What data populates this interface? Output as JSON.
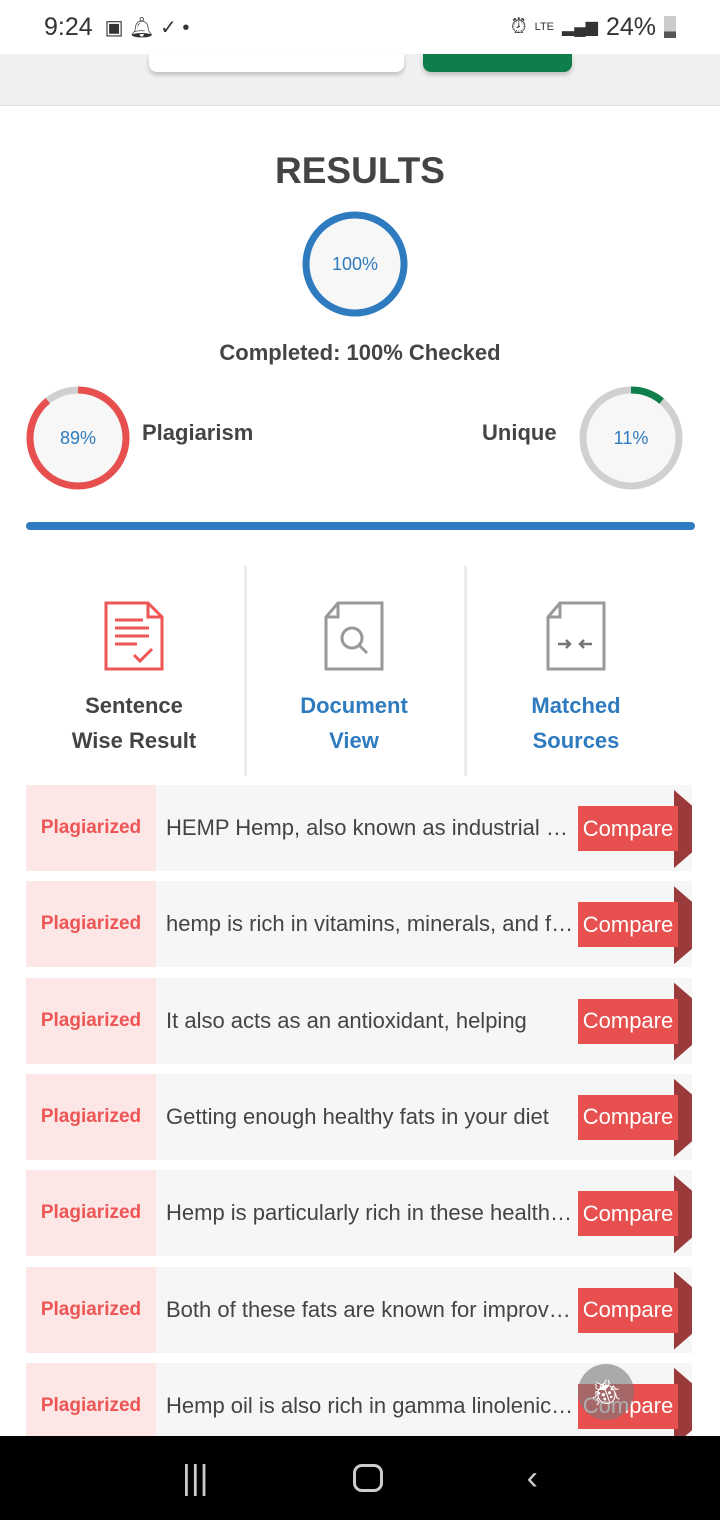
{
  "status_bar": {
    "time": "9:24",
    "battery": "24%",
    "network": "LTE"
  },
  "results": {
    "title": "RESULTS",
    "progress_percent": 100,
    "progress_label": "100%",
    "completed_text": "Completed: 100% Checked"
  },
  "plagiarism": {
    "label": "Plagiarism",
    "percent": 89,
    "percent_label": "89%",
    "color": "#e84f4f"
  },
  "unique": {
    "label": "Unique",
    "percent": 11,
    "percent_label": "11%",
    "color": "#0e7e4a"
  },
  "options": [
    {
      "label_line1": "Sentence",
      "label_line2": "Wise Result",
      "active": true
    },
    {
      "label_line1": "Document",
      "label_line2": "View"
    },
    {
      "label_line1": "Matched",
      "label_line2": "Sources"
    }
  ],
  "rows": [
    {
      "tag": "Plagiarized",
      "text": "HEMP Hemp, also known as industrial hemp",
      "button": "Compare"
    },
    {
      "tag": "Plagiarized",
      "text": "hemp is rich in vitamins, minerals, and fiber",
      "button": "Compare"
    },
    {
      "tag": "Plagiarized",
      "text": "It also acts as an antioxidant, helping",
      "button": "Compare"
    },
    {
      "tag": "Plagiarized",
      "text": "Getting enough healthy fats in your diet",
      "button": "Compare"
    },
    {
      "tag": "Plagiarized",
      "text": "Hemp is particularly rich in these healthy fats",
      "button": "Compare"
    },
    {
      "tag": "Plagiarized",
      "text": "Both of these fats are known for improving",
      "button": "Compare"
    },
    {
      "tag": "Plagiarized",
      "text": "Hemp oil is also rich in gamma linolenic acid",
      "button": "Compare"
    }
  ]
}
